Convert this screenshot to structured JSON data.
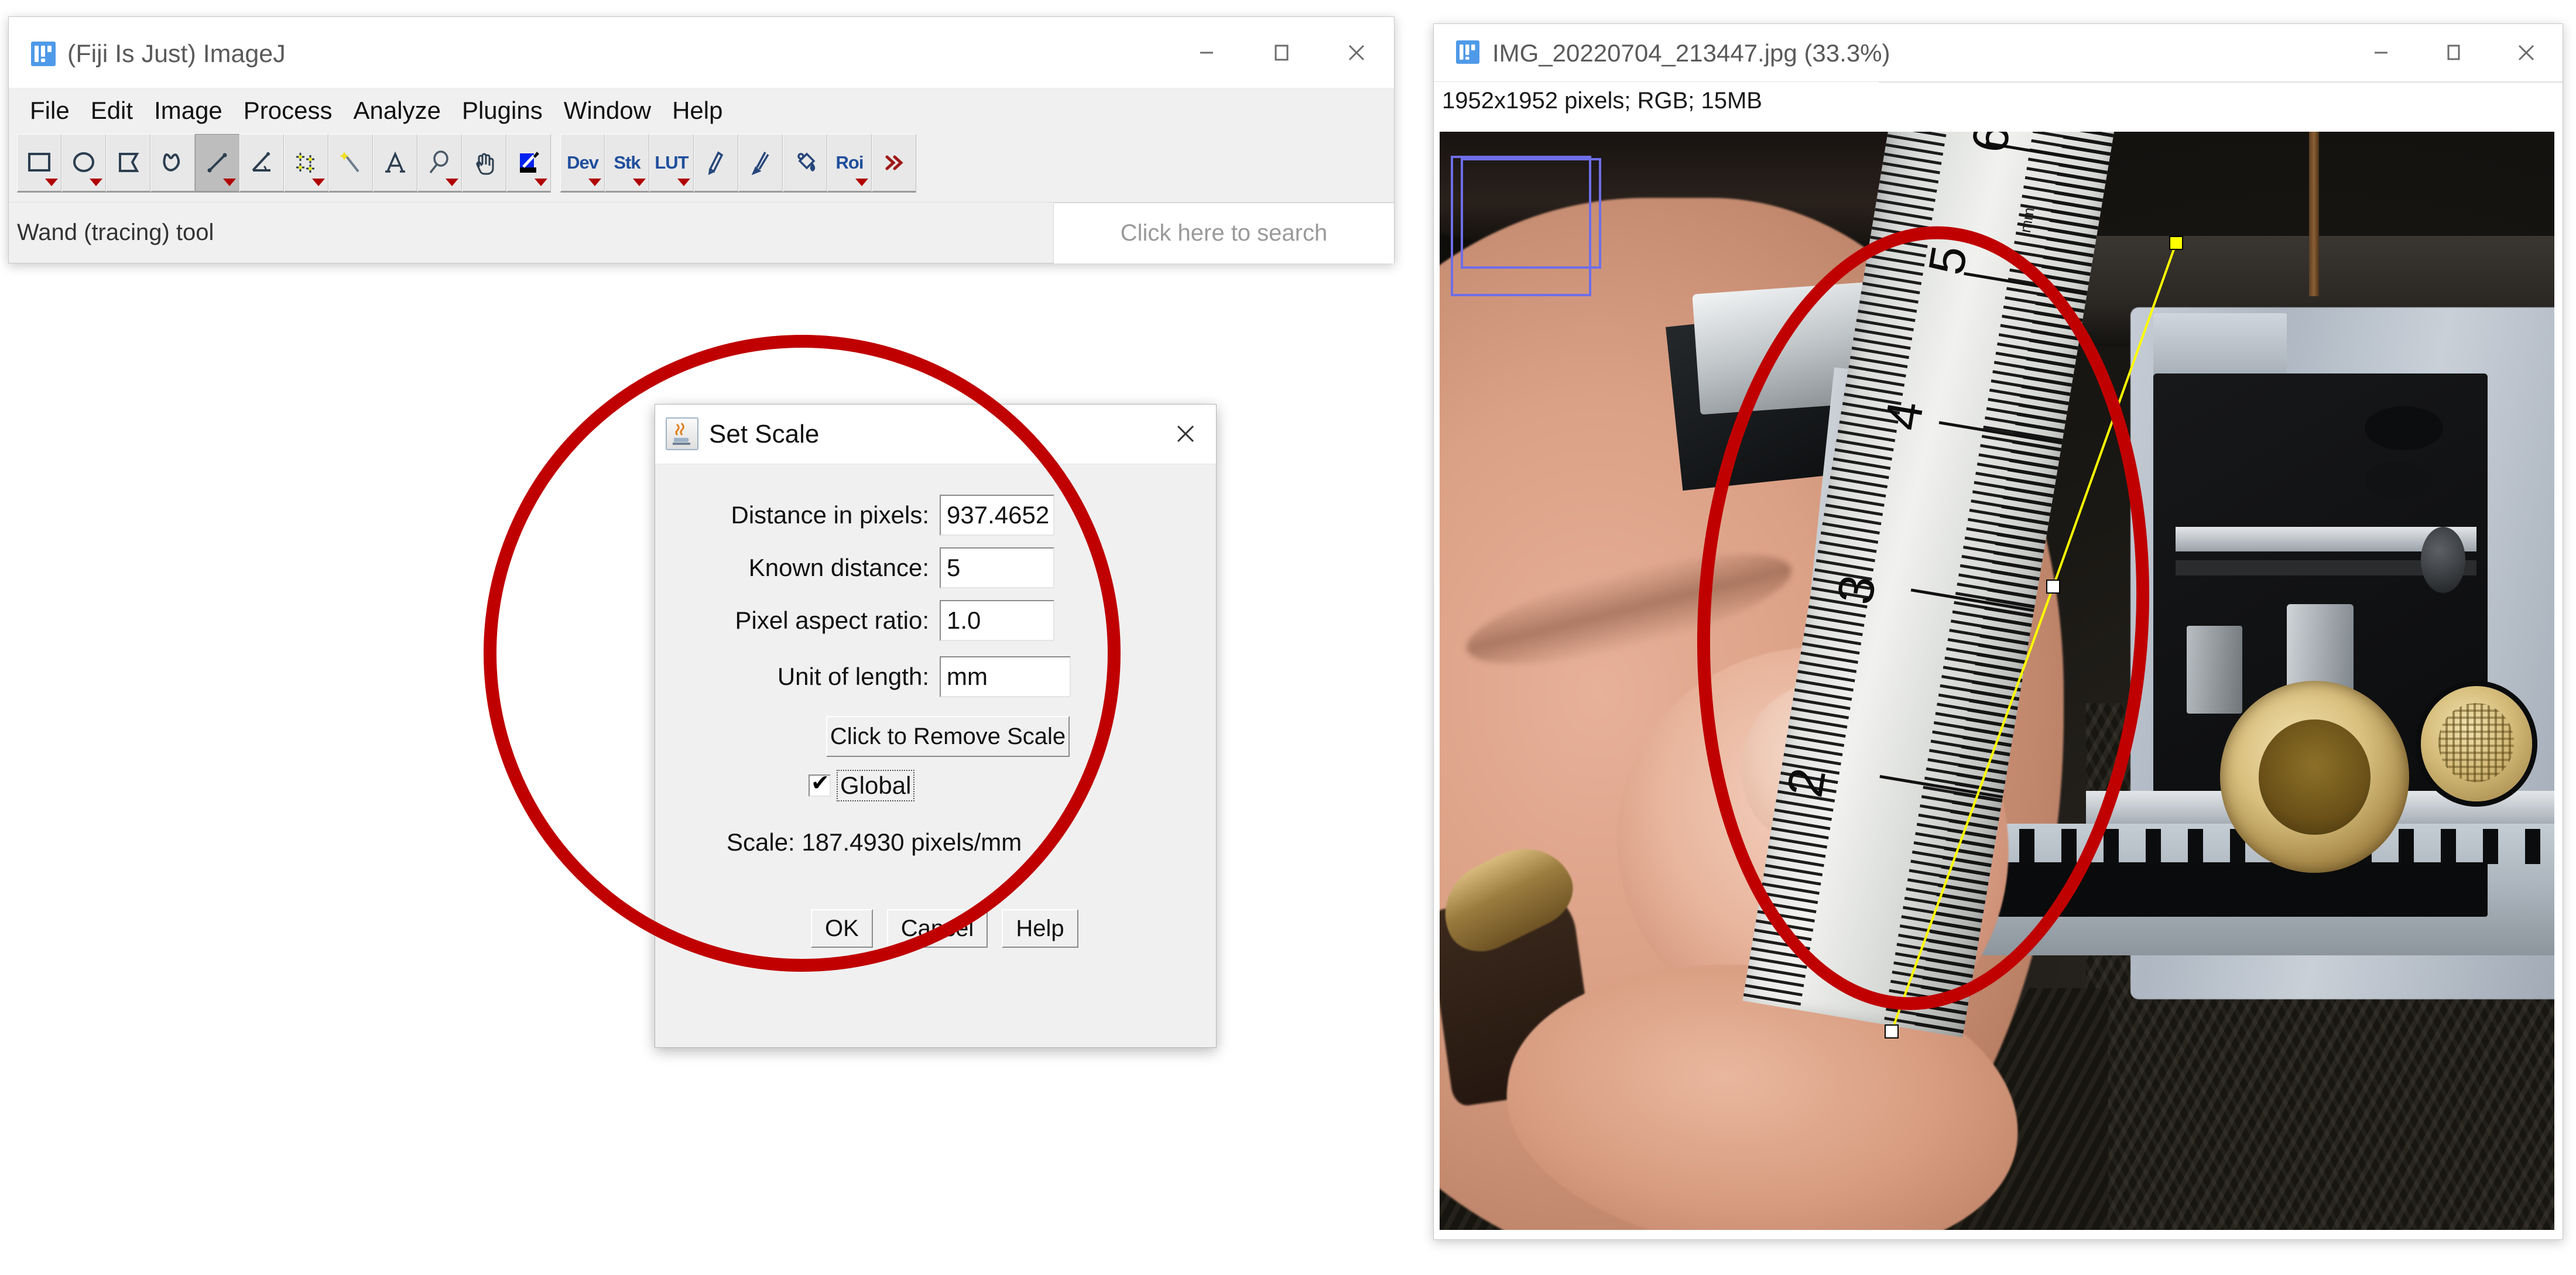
{
  "fiji": {
    "title": "(Fiji Is Just) ImageJ",
    "icon": "imagej-icon",
    "window_controls": [
      {
        "name": "minimize-button",
        "glyph": "minimize-icon"
      },
      {
        "name": "maximize-button",
        "glyph": "maximize-icon"
      },
      {
        "name": "close-button",
        "glyph": "close-icon"
      }
    ],
    "menu": [
      {
        "label": "File"
      },
      {
        "label": "Edit"
      },
      {
        "label": "Image"
      },
      {
        "label": "Process"
      },
      {
        "label": "Analyze"
      },
      {
        "label": "Plugins"
      },
      {
        "label": "Window"
      },
      {
        "label": "Help"
      }
    ],
    "toolbar": [
      {
        "icon": "rectangle-selection-icon",
        "label": "",
        "dropdown": true,
        "selected": false
      },
      {
        "icon": "oval-selection-icon",
        "label": "",
        "dropdown": true,
        "selected": false
      },
      {
        "icon": "polygon-selection-icon",
        "label": "",
        "dropdown": false,
        "selected": false
      },
      {
        "icon": "freehand-selection-icon",
        "label": "",
        "dropdown": false,
        "selected": false
      },
      {
        "icon": "straight-line-icon",
        "label": "",
        "dropdown": true,
        "selected": true
      },
      {
        "icon": "angle-tool-icon",
        "label": "",
        "dropdown": false,
        "selected": false
      },
      {
        "icon": "point-multipoint-icon",
        "label": "",
        "dropdown": true,
        "selected": false
      },
      {
        "icon": "wand-tracing-icon",
        "label": "",
        "dropdown": false,
        "selected": false
      },
      {
        "icon": "text-tool-icon",
        "label": "",
        "dropdown": false,
        "selected": false
      },
      {
        "icon": "magnifier-icon",
        "label": "",
        "dropdown": true,
        "selected": false
      },
      {
        "icon": "hand-scroll-icon",
        "label": "",
        "dropdown": false,
        "selected": false
      },
      {
        "icon": "color-picker-icon",
        "label": "",
        "dropdown": true,
        "selected": false
      },
      {
        "icon": "dev-label-icon",
        "label": "Dev",
        "dropdown": true,
        "selected": false
      },
      {
        "icon": "stk-label-icon",
        "label": "Stk",
        "dropdown": true,
        "selected": false
      },
      {
        "icon": "lut-label-icon",
        "label": "LUT",
        "dropdown": true,
        "selected": false
      },
      {
        "icon": "pencil-icon",
        "label": "",
        "dropdown": false,
        "selected": false
      },
      {
        "icon": "paintbrush-icon",
        "label": "",
        "dropdown": false,
        "selected": false
      },
      {
        "icon": "flood-fill-icon",
        "label": "",
        "dropdown": false,
        "selected": false
      },
      {
        "icon": "roi-label-icon",
        "label": "Roi",
        "dropdown": true,
        "selected": false
      },
      {
        "icon": "more-tools-chevrons-icon",
        "label": "",
        "dropdown": false,
        "selected": false
      }
    ],
    "status_text": "Wand (tracing) tool",
    "search_placeholder": "Click here to search"
  },
  "image_window": {
    "title": "IMG_20220704_213447.jpg (33.3%)",
    "icon": "imagej-icon",
    "info": "1952x1952 pixels; RGB; 15MB",
    "zoom_percent": "33.3%",
    "dimensions": "1952x1952",
    "color_mode": "RGB",
    "file_size": "15MB",
    "window_controls": [
      {
        "name": "minimize-button",
        "glyph": "minimize-icon"
      },
      {
        "name": "maximize-button",
        "glyph": "maximize-icon"
      },
      {
        "name": "close-button",
        "glyph": "close-icon"
      }
    ],
    "overlays": {
      "roi_color": "#6e6ee8",
      "line_color": "#ffff00",
      "handle_color": "#ffffff",
      "ruler_numbers": [
        "6",
        "5",
        "4",
        "3",
        "2"
      ],
      "ruler_unit_label": "mm"
    }
  },
  "set_scale": {
    "title": "Set Scale",
    "icon": "java-coffee-icon",
    "close_label": "close-icon",
    "fields": [
      {
        "name": "distance-in-pixels",
        "label": "Distance in pixels:",
        "value": "937.4652"
      },
      {
        "name": "known-distance",
        "label": "Known distance:",
        "value": "5"
      },
      {
        "name": "pixel-aspect-ratio",
        "label": "Pixel aspect ratio:",
        "value": "1.0"
      },
      {
        "name": "unit-of-length",
        "label": "Unit of length:",
        "value": "mm"
      }
    ],
    "remove_scale_label": "Click to Remove Scale",
    "global_label": "Global",
    "global_checked": true,
    "scale_text": "Scale: 187.4930 pixels/mm",
    "scale_value": "187.4930",
    "scale_units": "pixels/mm",
    "buttons": [
      {
        "name": "ok-button",
        "label": "OK"
      },
      {
        "name": "cancel-button",
        "label": "Cancel"
      },
      {
        "name": "help-button",
        "label": "Help"
      }
    ]
  },
  "annotations": {
    "color": "#c00000",
    "shapes": [
      {
        "name": "annotation-circle-dialog",
        "kind": "circle"
      },
      {
        "name": "annotation-ellipse-photo",
        "kind": "ellipse"
      }
    ]
  }
}
